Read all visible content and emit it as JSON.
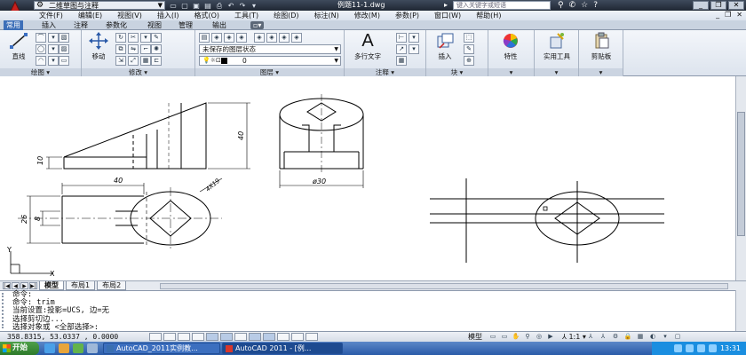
{
  "titlebar": {
    "workspace": "二维草图与注释",
    "document_title": "例题11-1.dwg",
    "search_placeholder": "键入关键字或短语"
  },
  "menubar": {
    "items": [
      "文件(F)",
      "编辑(E)",
      "视图(V)",
      "插入(I)",
      "格式(O)",
      "工具(T)",
      "绘图(D)",
      "标注(N)",
      "修改(M)",
      "参数(P)",
      "窗口(W)",
      "帮助(H)"
    ]
  },
  "ribbon_tabs": {
    "tabs": [
      "常用",
      "插入",
      "注释",
      "参数化",
      "视图",
      "管理",
      "输出"
    ],
    "active": "常用"
  },
  "ribbon": {
    "draw": {
      "line_label": "直线",
      "title": "绘图"
    },
    "modify": {
      "move_label": "移动",
      "title": "修改"
    },
    "layers": {
      "state_combo": "未保存的图层状态",
      "layer_combo": "0",
      "title": "图层"
    },
    "annotation": {
      "mtext_label": "多行文字",
      "title": "注释"
    },
    "block": {
      "insert_label": "插入",
      "title": "块"
    },
    "properties": {
      "label": "特性"
    },
    "utilities": {
      "label": "实用工具"
    },
    "clipboard": {
      "label": "剪贴板"
    }
  },
  "drawing": {
    "dims": {
      "d40_top": "40",
      "d10": "10",
      "d40_side": "40",
      "d30": "ø30",
      "d26": "26",
      "d8": "8",
      "dlabel": "4X19"
    },
    "ucs_y": "Y",
    "ucs_x": "X"
  },
  "layout_tabs": {
    "tabs": [
      "模型",
      "布局1",
      "布局2"
    ],
    "active": "模型"
  },
  "command_line": {
    "lines": [
      "命令:",
      "命令:  trim",
      "当前设置:投影=UCS, 边=无",
      "选择剪切边...",
      "选择对象或 <全部选择>:"
    ]
  },
  "statusbar": {
    "coords": "358.8315, 53.0337 , 0.0000",
    "model": "模型",
    "scale": "1:1"
  },
  "taskbar": {
    "start": "开始",
    "items": [
      "AutoCAD_2011实例教...",
      "AutoCAD 2011 - [例..."
    ],
    "clock": "13:31"
  }
}
